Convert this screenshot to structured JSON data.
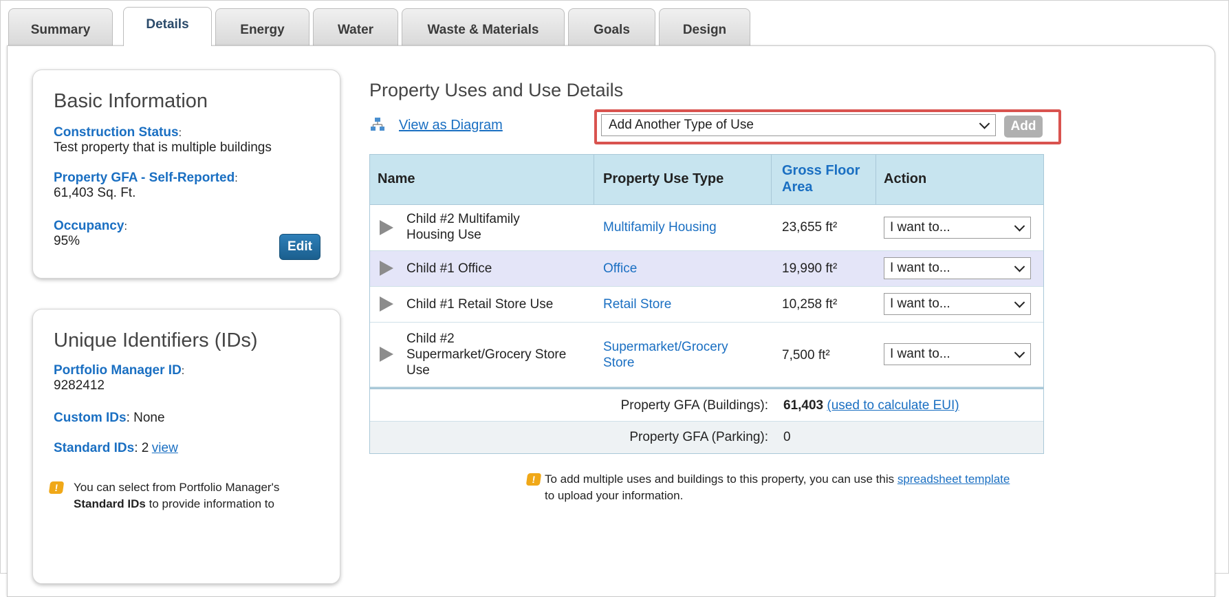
{
  "tabs": [
    "Summary",
    "Details",
    "Energy",
    "Water",
    "Waste & Materials",
    "Goals",
    "Design"
  ],
  "active_tab": "Details",
  "basic_info": {
    "title": "Basic Information",
    "construction_status_label": "Construction Status",
    "construction_status_value": "Test property that is multiple buildings",
    "gfa_label": "Property GFA - Self-Reported",
    "gfa_value": "61,403 Sq. Ft.",
    "occupancy_label": "Occupancy",
    "occupancy_value": "95%",
    "edit_label": "Edit"
  },
  "ids": {
    "title": "Unique Identifiers (IDs)",
    "pm_id_label": "Portfolio Manager ID",
    "pm_id_value": "9282412",
    "custom_label": "Custom IDs",
    "custom_value": "None",
    "standard_label": "Standard IDs",
    "standard_value": "2",
    "standard_link": "view",
    "note_line1": "You can select from Portfolio Manager's",
    "note_bold": "Standard IDs",
    "note_line2_rest": "to provide information to"
  },
  "uses": {
    "title": "Property Uses and Use Details",
    "view_diagram": "View as Diagram",
    "add_select_value": "Add Another Type of Use",
    "add_button": "Add",
    "columns": {
      "name": "Name",
      "type": "Property Use Type",
      "gfa_line1": "Gross Floor",
      "gfa_line2": "Area",
      "action": "Action"
    },
    "rows": [
      {
        "name1": "Child #2 Multifamily",
        "name2": "Housing Use",
        "name3": "",
        "type1": "Multifamily Housing",
        "type2": "",
        "gfa": "23,655 ft²",
        "action": "I want to..."
      },
      {
        "name1": "Child #1 Office",
        "name2": "",
        "name3": "",
        "type1": "Office",
        "type2": "",
        "gfa": "19,990 ft²",
        "action": "I want to..."
      },
      {
        "name1": "Child #1 Retail Store Use",
        "name2": "",
        "name3": "",
        "type1": "Retail Store",
        "type2": "",
        "gfa": "10,258 ft²",
        "action": "I want to..."
      },
      {
        "name1": "Child #2",
        "name2": "Supermarket/Grocery Store",
        "name3": "Use",
        "type1": "Supermarket/Grocery",
        "type2": "Store",
        "gfa": "7,500 ft²",
        "action": "I want to..."
      }
    ],
    "gfa_buildings_label": "Property GFA (Buildings):",
    "gfa_buildings_value": "61,403",
    "gfa_buildings_link": "(used to calculate EUI)",
    "gfa_parking_label": "Property GFA (Parking):",
    "gfa_parking_value": "0",
    "note_pre": "To add multiple uses and buildings to this property, you can use this",
    "note_link": "spreadsheet template",
    "note_line2": "to upload your information."
  },
  "colors": {
    "link": "#1a6fc2",
    "header_bg": "#c7e4ef",
    "selected_row": "#e4e5f8",
    "highlight": "#d9534f",
    "info_icon": "#f0a818"
  }
}
